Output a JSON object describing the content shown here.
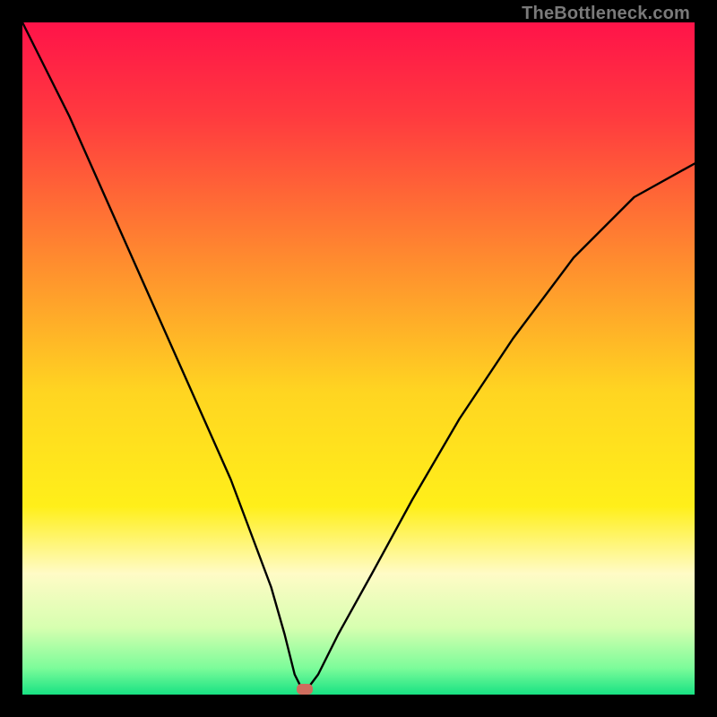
{
  "watermark": {
    "text": "TheBottleneck.com"
  },
  "chart_data": {
    "type": "line",
    "title": "",
    "xlabel": "",
    "ylabel": "",
    "xlim": [
      0,
      100
    ],
    "ylim": [
      0,
      100
    ],
    "background": {
      "type": "vertical-gradient",
      "stops": [
        {
          "pct": 0,
          "color": "#ff1349"
        },
        {
          "pct": 14,
          "color": "#ff3a3f"
        },
        {
          "pct": 35,
          "color": "#ff8a2f"
        },
        {
          "pct": 55,
          "color": "#ffd521"
        },
        {
          "pct": 72,
          "color": "#ffef1a"
        },
        {
          "pct": 82,
          "color": "#fffbc6"
        },
        {
          "pct": 90,
          "color": "#d7ffb0"
        },
        {
          "pct": 96,
          "color": "#7dfc9a"
        },
        {
          "pct": 100,
          "color": "#18e283"
        }
      ]
    },
    "series": [
      {
        "name": "bottleneck-curve",
        "color": "#000000",
        "x": [
          0,
          3,
          7,
          11,
          15,
          19,
          23,
          27,
          31,
          34,
          37,
          39,
          40.5,
          41.5,
          42.5,
          44,
          47,
          52,
          58,
          65,
          73,
          82,
          91,
          100
        ],
        "y": [
          100,
          94,
          86,
          77,
          68,
          59,
          50,
          41,
          32,
          24,
          16,
          9,
          3,
          1,
          1,
          3,
          9,
          18,
          29,
          41,
          53,
          65,
          74,
          79
        ]
      }
    ],
    "marker": {
      "x": 42,
      "y": 0.8,
      "color": "#cf6d5e"
    },
    "frame_color": "#000000"
  }
}
